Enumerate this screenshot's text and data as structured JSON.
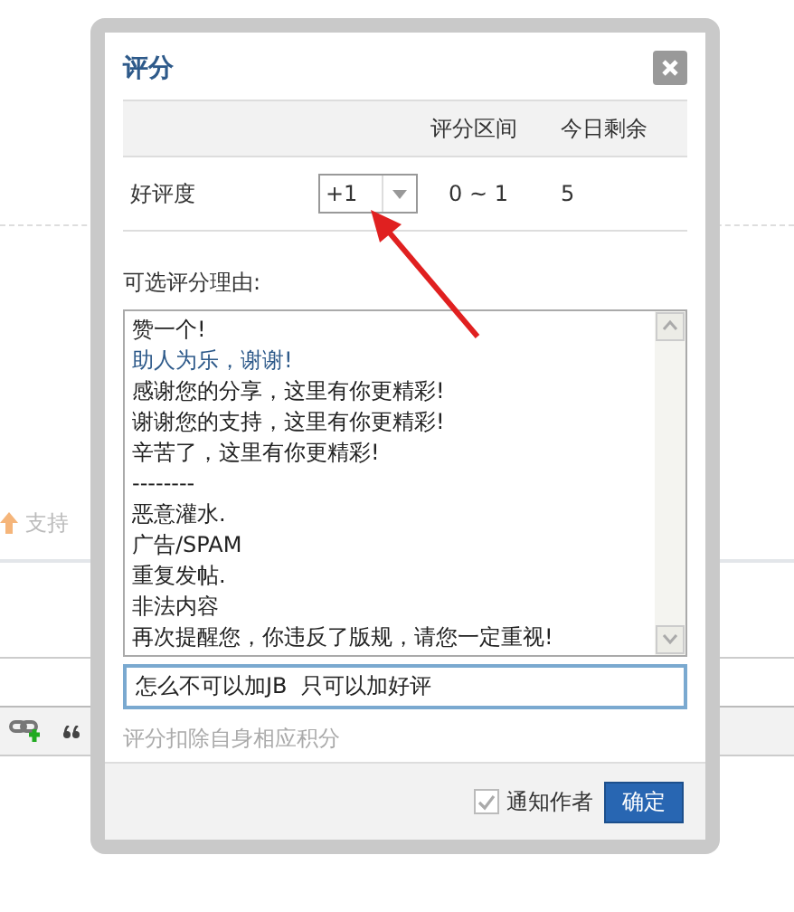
{
  "background": {
    "vote_label": "支持"
  },
  "dialog": {
    "title": "评分",
    "table": {
      "columns": [
        "评分区间",
        "今日剩余"
      ],
      "rows": [
        {
          "label": "好评度",
          "score": "+1",
          "range": "0 ~ 1",
          "remaining": "5"
        }
      ]
    },
    "reasons_label": "可选评分理由:",
    "reasons": [
      {
        "text": "赞一个!",
        "selected": false
      },
      {
        "text": "助人为乐，谢谢!",
        "selected": true
      },
      {
        "text": "感谢您的分享，这里有你更精彩!",
        "selected": false
      },
      {
        "text": "谢谢您的支持，这里有你更精彩!",
        "selected": false
      },
      {
        "text": "辛苦了，这里有你更精彩!",
        "selected": false
      },
      {
        "text": "--------",
        "selected": false
      },
      {
        "text": "恶意灌水.",
        "selected": false
      },
      {
        "text": "广告/SPAM",
        "selected": false
      },
      {
        "text": "重复发帖.",
        "selected": false
      },
      {
        "text": "非法内容",
        "selected": false
      },
      {
        "text": "再次提醒您，你违反了版规，请您一定重视!",
        "selected": false
      }
    ],
    "reason_input": {
      "value": "怎么不可以加JB  只可以加好评"
    },
    "hint": "评分扣除自身相应积分",
    "notify": {
      "label": "通知作者",
      "checked": true
    },
    "confirm_button": "确定"
  }
}
